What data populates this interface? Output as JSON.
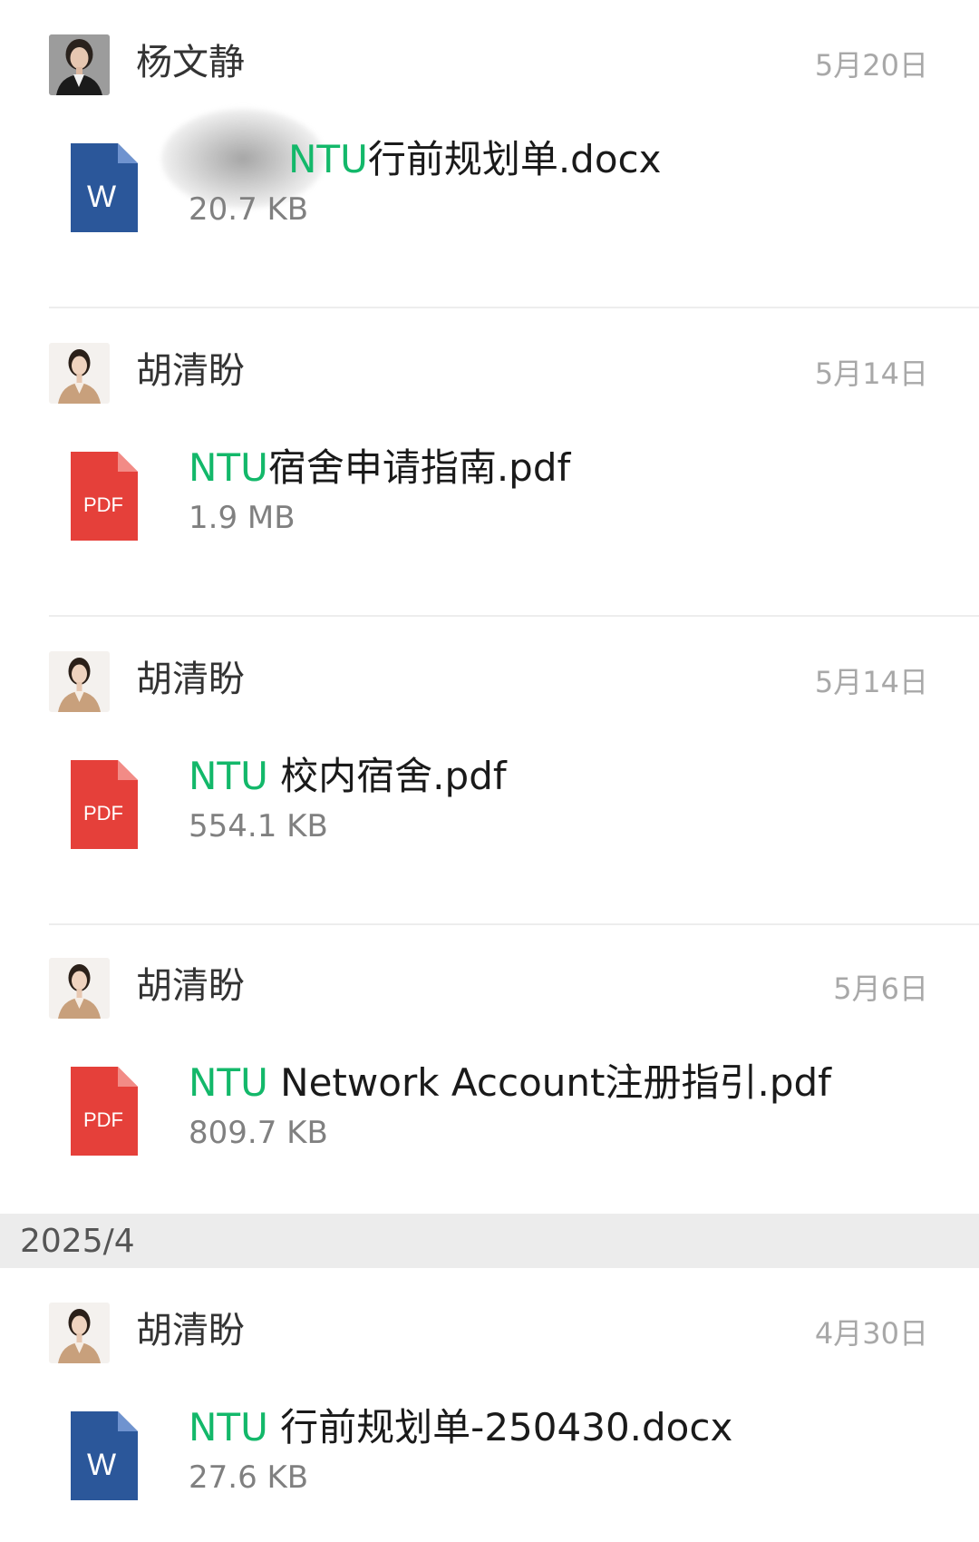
{
  "section_header": "2025/4",
  "colors": {
    "highlight": "#13b86a",
    "word_blue": "#2b579a",
    "pdf_red": "#e5403a",
    "date_gray": "#a8a8a8"
  },
  "entries": [
    {
      "sender": "杨文静",
      "date": "5月20日",
      "file_icon": "word-doc-icon",
      "file_icon_label": "W",
      "file_name_prefix": "",
      "file_name_highlight": "NTU",
      "file_name_rest": "行前规划单.docx",
      "file_size": "20.7 KB"
    },
    {
      "sender": "胡清盼",
      "date": "5月14日",
      "file_icon": "pdf-doc-icon",
      "file_icon_label": "PDF",
      "file_name_prefix": "",
      "file_name_highlight": "NTU",
      "file_name_rest": "宿舍申请指南.pdf",
      "file_size": "1.9 MB"
    },
    {
      "sender": "胡清盼",
      "date": "5月14日",
      "file_icon": "pdf-doc-icon",
      "file_icon_label": "PDF",
      "file_name_prefix": "",
      "file_name_highlight": "NTU",
      "file_name_rest": " 校内宿舍.pdf",
      "file_size": "554.1 KB"
    },
    {
      "sender": "胡清盼",
      "date": "5月6日",
      "file_icon": "pdf-doc-icon",
      "file_icon_label": "PDF",
      "file_name_prefix": "",
      "file_name_highlight": "NTU",
      "file_name_rest": " Network Account注册指引.pdf",
      "file_size": "809.7 KB"
    },
    {
      "sender": "胡清盼",
      "date": "4月30日",
      "file_icon": "word-doc-icon",
      "file_icon_label": "W",
      "file_name_prefix": "",
      "file_name_highlight": "NTU",
      "file_name_rest": " 行前规划单-250430.docx",
      "file_size": "27.6 KB"
    }
  ]
}
